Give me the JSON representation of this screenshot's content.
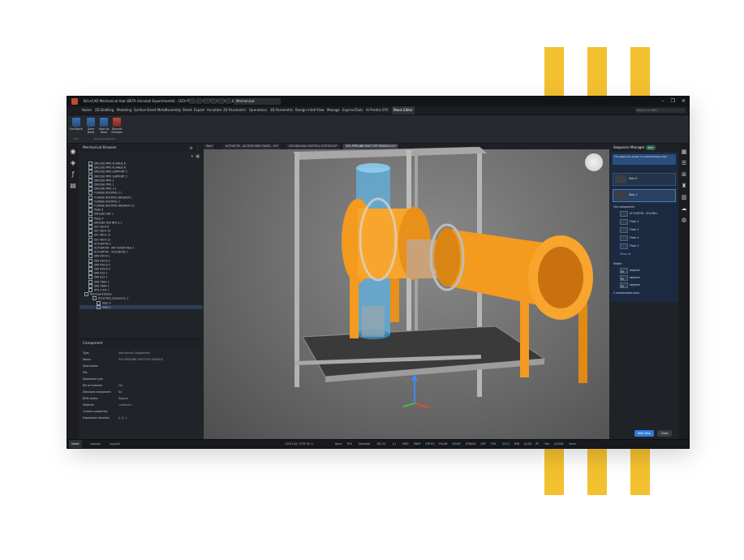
{
  "window": {
    "title": "BricsCAD Mechanical Hub (BETA Uninstall Experimental) - [XZV-PIPELINE-SHUT-OFF-MODULE-01.dwg]",
    "workspace": "Mechanical",
    "controls": [
      "–",
      "❐",
      "✕"
    ]
  },
  "menu": {
    "items": [
      "Home",
      "2D Drafting",
      "Modeling",
      "Surface",
      "Sheet Metal",
      "Assembly",
      "Sheet",
      "Export",
      "Annotate",
      "2D Parametric",
      "Operations",
      "3D Parametric",
      "Design Intell",
      "View",
      "Manage",
      "ExpressTools",
      "AI Predict",
      "STK",
      "Block Editor"
    ],
    "active_index": 18,
    "search_placeholder": "Search in Wiki..."
  },
  "ribbon": {
    "buttons": [
      {
        "label": "Exit Block"
      },
      {
        "label": "Save Block"
      },
      {
        "label": "Save As Block"
      },
      {
        "label": "Discard Changes"
      }
    ],
    "groups": [
      "Exit",
      "Save and Discard"
    ]
  },
  "browser": {
    "title": "Mechanical Browser",
    "items": [
      {
        "label": "DN1200 PIPE FLANGE 6",
        "indent": 1
      },
      {
        "label": "DN1200 PIPE FLANGE 6",
        "indent": 1
      },
      {
        "label": "DN1200 PIPE SUPPORT 2",
        "indent": 1
      },
      {
        "label": "DN1200 PIPE SUPPORT 2",
        "indent": 1
      },
      {
        "label": "DN1200 PIPE 1",
        "indent": 1
      },
      {
        "label": "DN1200 PIPE 1",
        "indent": 1
      },
      {
        "label": "DN1200 PIPE 3.1",
        "indent": 1
      },
      {
        "label": "FLANGE BOLTING 2.1",
        "indent": 1
      },
      {
        "label": "FLANGE BOLTING WASHER 1",
        "indent": 1
      },
      {
        "label": "FLANGE BOLTING 3",
        "indent": 1
      },
      {
        "label": "FLANGE BOLTING WASHER 3.1",
        "indent": 1
      },
      {
        "label": "Plate 3",
        "indent": 1
      },
      {
        "label": "DN1200 GKT 1",
        "indent": 1
      },
      {
        "label": "Plate 4",
        "indent": 1
      },
      {
        "label": "DN1200 ISW BPS 3.1",
        "indent": 1
      },
      {
        "label": "ISO 4014 6",
        "indent": 1
      },
      {
        "label": "ISO 4014 10",
        "indent": 1
      },
      {
        "label": "ISO 4014 11",
        "indent": 1
      },
      {
        "label": "ISO 4014 12",
        "indent": 1
      },
      {
        "label": "ACTUATOR 1",
        "indent": 1
      },
      {
        "label": "ACTUATOR - AIR FILTER REG 1",
        "indent": 1
      },
      {
        "label": "ACTUATOR - SOLENOID 1",
        "indent": 1
      },
      {
        "label": "DIN 439 B 1",
        "indent": 1
      },
      {
        "label": "DIN 439 B 2",
        "indent": 1
      },
      {
        "label": "DIN 439 B 3",
        "indent": 1
      },
      {
        "label": "DIN 439 B 4",
        "indent": 1
      },
      {
        "label": "DIN 912 1",
        "indent": 1
      },
      {
        "label": "DIN 912 2",
        "indent": 1
      },
      {
        "label": "DIN 7984 1",
        "indent": 1
      },
      {
        "label": "DIN 7984 2",
        "indent": 1
      },
      {
        "label": "RTX 2 KIT 1",
        "indent": 1
      },
      {
        "label": "Representations",
        "indent": 0
      },
      {
        "label": "Assembly_Sequence_1",
        "indent": 2
      },
      {
        "label": "Step 0",
        "indent": 3
      },
      {
        "label": "Step 1",
        "indent": 3,
        "selected": true
      }
    ]
  },
  "properties": {
    "title": "Component",
    "rows": [
      {
        "k": "Type",
        "v": "Mechanical Component"
      },
      {
        "k": "Name",
        "v": "XZV-PIPELINE-SHUT-OFF-MODULE"
      },
      {
        "k": "Description",
        "v": ""
      },
      {
        "k": "File",
        "v": ""
      },
      {
        "k": "Download type",
        "v": ""
      },
      {
        "k": "Bill of material",
        "v": "Yes"
      },
      {
        "k": "Standard component",
        "v": "No"
      },
      {
        "k": "BOM status",
        "v": "Regular"
      },
      {
        "k": "Material",
        "v": "<default>"
      },
      {
        "k": "Custom properties",
        "v": ""
      },
      {
        "k": "Explorable direction",
        "v": "0, 0, 1"
      }
    ]
  },
  "viewport": {
    "tabs": [
      "Start",
      "ACTUATOR - ACCESSORIES PANEL - XY*",
      "XZV-DN1200-CONTROL-SYSTEM-01*",
      "XZV-PIPELINE-SHUT-OFF-MODULE-01*"
    ],
    "active_tab": 3
  },
  "sequence": {
    "title": "Sequence Manager",
    "exit_label": "Exit",
    "info": "The steps are shown in a streamlined order",
    "steps": [
      {
        "label": "Step 0"
      },
      {
        "label": "Step 1"
      }
    ],
    "section_components": "Old components",
    "components": [
      "ACTUATOR - SOLENO..",
      "Plate 4",
      "Plate 4",
      "Plate 4",
      "Plate 4"
    ],
    "show_all": "Show all",
    "section_rotate": "Rotate",
    "rotations": [
      {
        "value": "90",
        "unit": "degrees"
      },
      {
        "value": "90",
        "unit": "degrees"
      },
      {
        "value": "90",
        "unit": "degrees"
      }
    ],
    "selected_count": "5 manipulated parts",
    "btn_next": "Next Step",
    "btn_close": "Close"
  },
  "status": {
    "tabs": [
      "Model",
      "Layout1",
      "Layout2"
    ],
    "coords": "12251.44, 4778.78, 0",
    "items": [
      "None",
      "TILE",
      "Standard",
      "ISO-25",
      "1:1",
      "GRID",
      "SNAP",
      "ORTHO",
      "POLAR",
      "ESNAP",
      "STRACK",
      "LWT",
      "TILE",
      "DUCS",
      "DYN",
      "QUAD",
      "RT",
      "HKA",
      "LOCKUI",
      "None"
    ]
  },
  "colors": {
    "accent": "#2f7de0",
    "model_orange": "#f39a1f",
    "model_blue": "#5fb6e6",
    "decor_yellow": "#f3c12f"
  }
}
